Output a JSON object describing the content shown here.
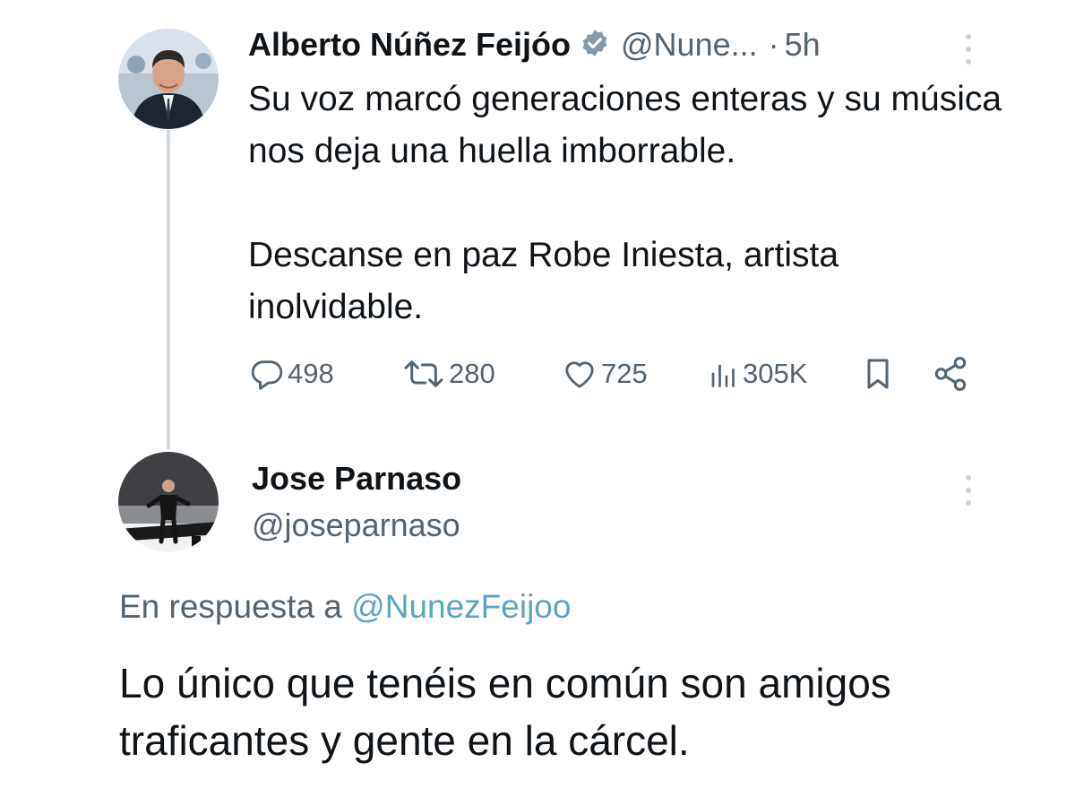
{
  "post": {
    "author_name": "Alberto Núñez Feijóo",
    "handle": "@Nune...",
    "separator": "·",
    "time": "5h",
    "text_paragraphs": [
      "Su voz marcó generaciones enteras y su música nos deja una huella imborrable.",
      "Descanse en paz Robe Iniesta, artista inolvidable."
    ],
    "verified_badge_color": "#829aab",
    "actions": {
      "replies": "498",
      "reposts": "280",
      "likes": "725",
      "views": "305K"
    }
  },
  "reply": {
    "author_name": "Jose Parnaso",
    "handle": "@joseparnaso",
    "in_reply_prefix": "En respuesta a",
    "in_reply_handle": "@NunezFeijoo",
    "text": "Lo único que tenéis en común son amigos traficantes y gente en la cárcel."
  },
  "icons": {
    "post_avatar": "profile-photo",
    "reply_avatar": "profile-photo",
    "verified": "verified-badge-icon",
    "reply": "comment-icon",
    "repost": "repost-icon",
    "like": "heart-icon",
    "views": "bar-chart-icon",
    "bookmark": "bookmark-icon",
    "share": "share-icon",
    "more": "more-vertical-icon"
  }
}
